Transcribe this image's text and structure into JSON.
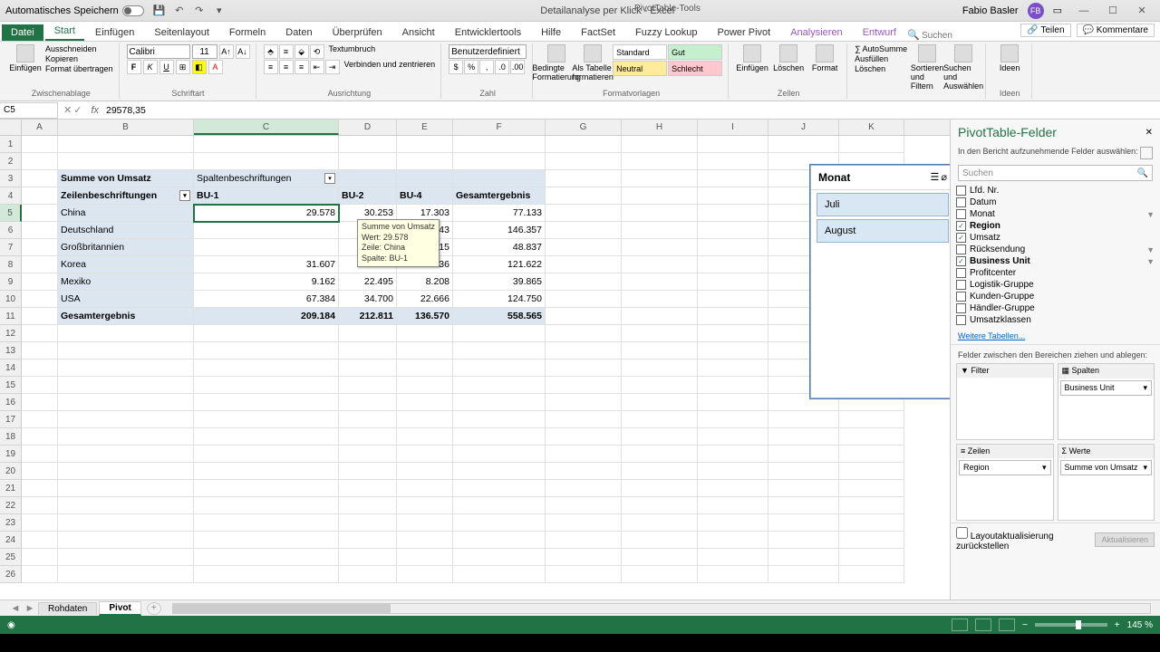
{
  "titlebar": {
    "autosave": "Automatisches Speichern",
    "doc_title": "Detailanalyse per Klick  -  Excel",
    "context_tools": "PivotTable-Tools",
    "user_name": "Fabio Basler",
    "user_initials": "FB"
  },
  "tabs": {
    "file": "Datei",
    "home": "Start",
    "insert": "Einfügen",
    "layout": "Seitenlayout",
    "formulas": "Formeln",
    "data": "Daten",
    "review": "Überprüfen",
    "view": "Ansicht",
    "dev": "Entwicklertools",
    "help": "Hilfe",
    "factset": "FactSet",
    "fuzzy": "Fuzzy Lookup",
    "powerpivot": "Power Pivot",
    "analyze": "Analysieren",
    "design": "Entwurf",
    "search_placeholder": "Suchen",
    "share": "Teilen",
    "comments": "Kommentare"
  },
  "ribbon": {
    "clipboard": {
      "label": "Zwischenablage",
      "paste": "Einfügen",
      "cut": "Ausschneiden",
      "copy": "Kopieren",
      "painter": "Format übertragen"
    },
    "font": {
      "label": "Schriftart",
      "name": "Calibri",
      "size": "11"
    },
    "align": {
      "label": "Ausrichtung",
      "wrap": "Textumbruch",
      "merge": "Verbinden und zentrieren"
    },
    "number": {
      "label": "Zahl",
      "format": "Benutzerdefiniert"
    },
    "condfmt": "Bedingte Formatierung",
    "astable": "Als Tabelle formatieren",
    "styles": {
      "label": "Formatvorlagen",
      "standard": "Standard",
      "gut": "Gut",
      "neutral": "Neutral",
      "schlecht": "Schlecht"
    },
    "cells": {
      "label": "Zellen",
      "insert": "Einfügen",
      "delete": "Löschen",
      "format": "Format"
    },
    "editing": {
      "autosum": "AutoSumme",
      "fill": "Ausfüllen",
      "clear": "Löschen",
      "sort": "Sortieren und Filtern",
      "find": "Suchen und Auswählen"
    },
    "ideas": {
      "label": "Ideen",
      "btn": "Ideen"
    }
  },
  "formula_bar": {
    "cell_ref": "C5",
    "value": "29578,35"
  },
  "columns": [
    "A",
    "B",
    "C",
    "D",
    "E",
    "F",
    "G",
    "H",
    "I",
    "J",
    "K"
  ],
  "pivot": {
    "title": "Summe von Umsatz",
    "col_label": "Spaltenbeschriftungen",
    "row_label": "Zeilenbeschriftungen",
    "col_headers": [
      "BU-1",
      "BU-2",
      "BU-4",
      "Gesamtergebnis"
    ],
    "rows": [
      {
        "label": "China",
        "vals": [
          "29.578",
          "30.253",
          "17.303",
          "77.133"
        ]
      },
      {
        "label": "Deutschland",
        "vals": [
          "",
          ".218",
          "52.443",
          "146.357"
        ]
      },
      {
        "label": "Großbritannien",
        "vals": [
          "",
          ".866",
          "13.215",
          "48.837"
        ]
      },
      {
        "label": "Korea",
        "vals": [
          "31.607",
          "67.280",
          "22.736",
          "121.622"
        ]
      },
      {
        "label": "Mexiko",
        "vals": [
          "9.162",
          "22.495",
          "8.208",
          "39.865"
        ]
      },
      {
        "label": "USA",
        "vals": [
          "67.384",
          "34.700",
          "22.666",
          "124.750"
        ]
      }
    ],
    "total": {
      "label": "Gesamtergebnis",
      "vals": [
        "209.184",
        "212.811",
        "136.570",
        "558.565"
      ]
    }
  },
  "tooltip": {
    "l1": "Summe von Umsatz",
    "l2": "Wert: 29.578",
    "l3": "Zeile: China",
    "l4": "Spalte: BU-1"
  },
  "slicer": {
    "title": "Monat",
    "items": [
      "Juli",
      "August"
    ]
  },
  "pane": {
    "title": "PivotTable-Felder",
    "subtitle": "In den Bericht aufzunehmende Felder auswählen:",
    "search_placeholder": "Suchen",
    "fields": [
      {
        "name": "Lfd. Nr.",
        "checked": false
      },
      {
        "name": "Datum",
        "checked": false
      },
      {
        "name": "Monat",
        "checked": false,
        "filter": true
      },
      {
        "name": "Region",
        "checked": true,
        "bold": true
      },
      {
        "name": "Umsatz",
        "checked": true
      },
      {
        "name": "Rücksendung",
        "checked": false,
        "filter": true
      },
      {
        "name": "Business Unit",
        "checked": true,
        "bold": true,
        "filter": true
      },
      {
        "name": "Profitcenter",
        "checked": false
      },
      {
        "name": "Logistik-Gruppe",
        "checked": false
      },
      {
        "name": "Kunden-Gruppe",
        "checked": false
      },
      {
        "name": "Händler-Gruppe",
        "checked": false
      },
      {
        "name": "Umsatzklassen",
        "checked": false
      }
    ],
    "more_tables": "Weitere Tabellen...",
    "drag_hint": "Felder zwischen den Bereichen ziehen und ablegen:",
    "filter_hdr": "Filter",
    "cols_hdr": "Spalten",
    "rows_hdr": "Zeilen",
    "vals_hdr": "Werte",
    "cols_item": "Business Unit",
    "rows_item": "Region",
    "vals_item": "Summe von Umsatz",
    "defer": "Layoutaktualisierung zurückstellen",
    "update": "Aktualisieren"
  },
  "sheets": {
    "s1": "Rohdaten",
    "s2": "Pivot"
  },
  "status": {
    "zoom": "145 %"
  }
}
